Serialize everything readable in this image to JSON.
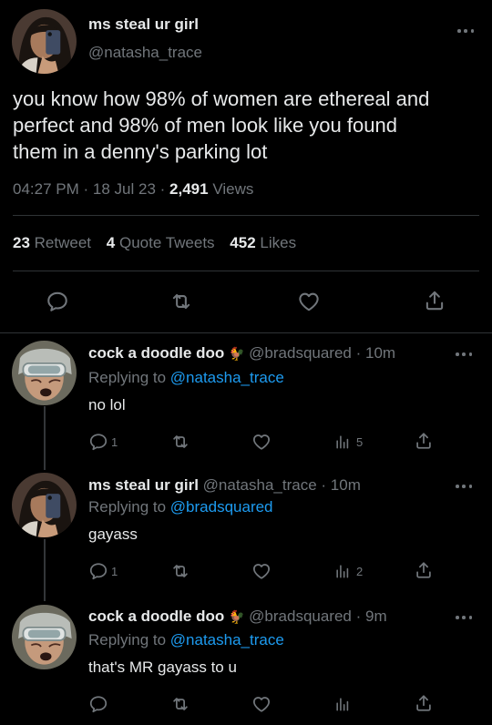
{
  "main_tweet": {
    "display_name": "ms steal ur girl",
    "handle": "@natasha_trace",
    "text_lines": [
      "you know how 98% of women are ethereal and",
      "perfect and 98% of men look like you found",
      "them in a denny's parking lot"
    ],
    "time": "04:27 PM",
    "sep1": "·",
    "date": "18 Jul 23",
    "sep2": "·",
    "views_count": "2,491",
    "views_label": "Views",
    "retweets_count": "23",
    "retweets_label": "Retweet",
    "quotes_count": "4",
    "quotes_label": "Quote Tweets",
    "likes_count": "452",
    "likes_label": "Likes"
  },
  "replies": [
    {
      "display_name": "cock a doodle doo",
      "emoji": "🐓",
      "handle": "@bradsquared",
      "time": "· 10m",
      "replying_prefix": "Replying to",
      "replying_handle": "@natasha_trace",
      "text": "no lol",
      "reply_count": "1",
      "views_count": "5"
    },
    {
      "display_name": "ms steal ur girl",
      "handle": "@natasha_trace",
      "time": "· 10m",
      "replying_prefix": "Replying to",
      "replying_handle": "@bradsquared",
      "text": "gayass",
      "reply_count": "1",
      "views_count": "2"
    },
    {
      "display_name": "cock a doodle doo",
      "emoji": "🐓",
      "handle": "@bradsquared",
      "time": "· 9m",
      "replying_prefix": "Replying to",
      "replying_handle": "@natasha_trace",
      "text": "that's MR gayass to u",
      "reply_count": "",
      "views_count": ""
    }
  ],
  "colors": {
    "accent": "#1d9bf0",
    "muted": "#71767b",
    "text": "#e7e9ea",
    "background": "#000000"
  },
  "icons": [
    "reply-icon",
    "retweet-icon",
    "like-icon",
    "share-icon",
    "views-icon",
    "more-icon"
  ]
}
